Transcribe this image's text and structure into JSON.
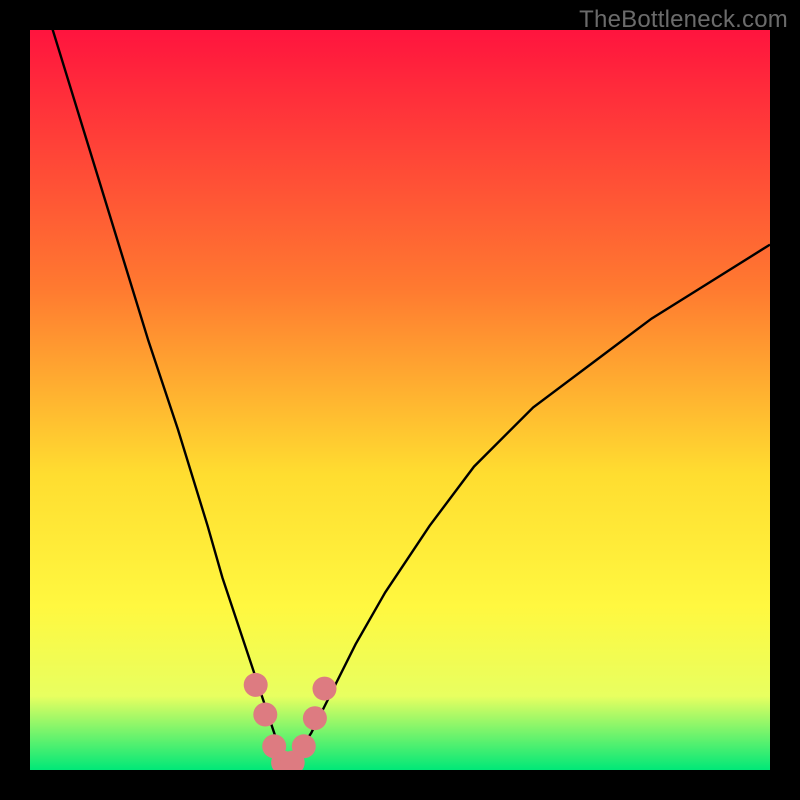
{
  "watermark": "TheBottleneck.com",
  "colors": {
    "gradient_top": "#ff143e",
    "gradient_mid1": "#ff7a30",
    "gradient_mid2": "#ffdd30",
    "gradient_mid3": "#fff840",
    "gradient_mid4": "#e8ff60",
    "gradient_bottom": "#00e878",
    "curve": "#000000",
    "marker_fill": "#dd7b81",
    "marker_stroke": "#c95f67"
  },
  "chart_data": {
    "type": "line",
    "title": "",
    "xlabel": "",
    "ylabel": "",
    "ylim": [
      0,
      100
    ],
    "xlim": [
      0,
      100
    ],
    "series": [
      {
        "name": "bottleneck-curve",
        "x": [
          0,
          4,
          8,
          12,
          16,
          20,
          24,
          26,
          28,
          30,
          32,
          33,
          34,
          35,
          36,
          38,
          40,
          44,
          48,
          54,
          60,
          68,
          76,
          84,
          92,
          100
        ],
        "y": [
          110,
          97,
          84,
          71,
          58,
          46,
          33,
          26,
          20,
          14,
          8,
          5,
          2,
          1,
          2,
          5,
          9,
          17,
          24,
          33,
          41,
          49,
          55,
          61,
          66,
          71
        ]
      }
    ],
    "markers": {
      "name": "highlight-band",
      "x": [
        30.5,
        31.8,
        33.0,
        34.2,
        35.5,
        37.0,
        38.5,
        39.8
      ],
      "y": [
        11.5,
        7.5,
        3.2,
        1.0,
        1.0,
        3.2,
        7.0,
        11.0
      ]
    },
    "legend": []
  }
}
